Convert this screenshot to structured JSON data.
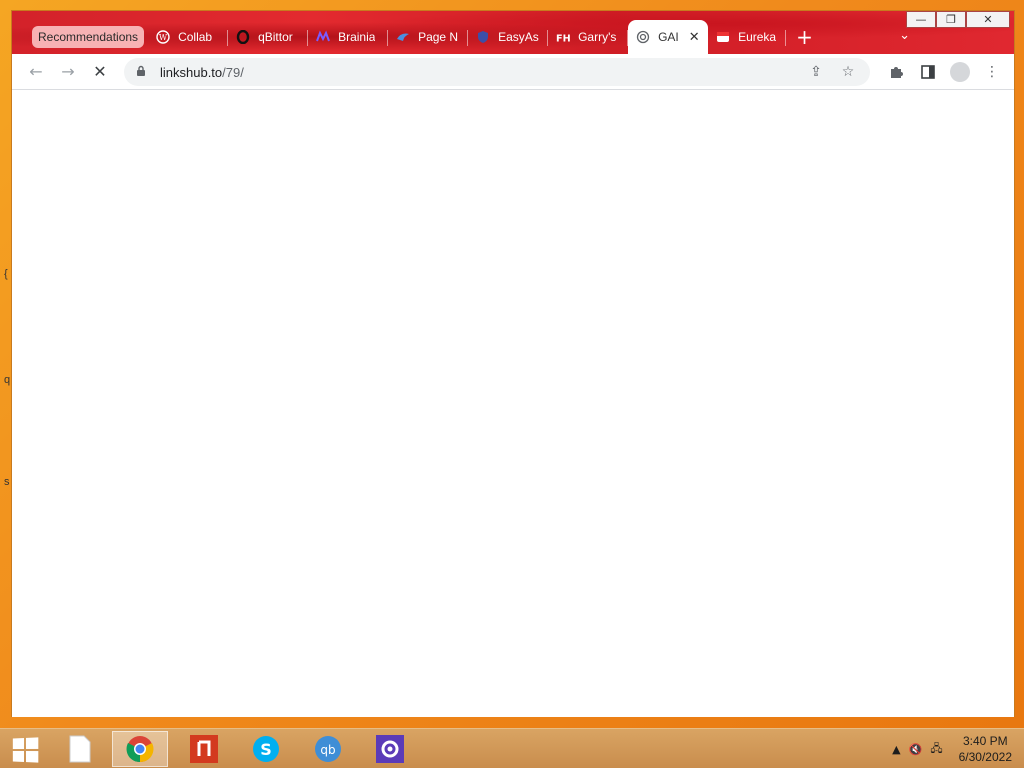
{
  "desktop": {
    "edge_glyphs": [
      "{",
      "q",
      "s"
    ]
  },
  "window_controls": {
    "minimize": "—",
    "restore": "❐",
    "close": "✕"
  },
  "tabs": {
    "recommendations_chip": "Recommendations",
    "items": [
      {
        "label": "Collab",
        "icon": "wordpress-icon"
      },
      {
        "label": "qBittor",
        "icon": "opera-icon"
      },
      {
        "label": "Brainia",
        "icon": "brainia-icon"
      },
      {
        "label": "Page N",
        "icon": "bird-icon"
      },
      {
        "label": "EasyAs",
        "icon": "shield-icon"
      },
      {
        "label": "Garry's",
        "icon": "fh-icon"
      },
      {
        "label": "GAI",
        "icon": "spiral-icon",
        "active": true
      },
      {
        "label": "Eureka",
        "icon": "eureka-icon"
      }
    ],
    "new_tab": "+",
    "tab_search": "⌄"
  },
  "toolbar": {
    "back": "←",
    "forward": "→",
    "stop": "✕",
    "url_host": "linkshub.to",
    "url_path": "/79/",
    "share": "⇪",
    "bookmark": "☆",
    "extensions": "✚",
    "side_panel": "▯",
    "menu": "⋮"
  },
  "taskbar": {
    "clock_time": "3:40 PM",
    "clock_date": "6/30/2022",
    "tray_up": "▲",
    "tray_volume": "🔇",
    "tray_network": "🖧",
    "apps": [
      {
        "name": "file-explorer-icon"
      },
      {
        "name": "chrome-icon",
        "active": true
      },
      {
        "name": "foxit-reader-icon"
      },
      {
        "name": "skype-icon"
      },
      {
        "name": "qbittorrent-icon"
      },
      {
        "name": "settings-icon"
      }
    ]
  }
}
